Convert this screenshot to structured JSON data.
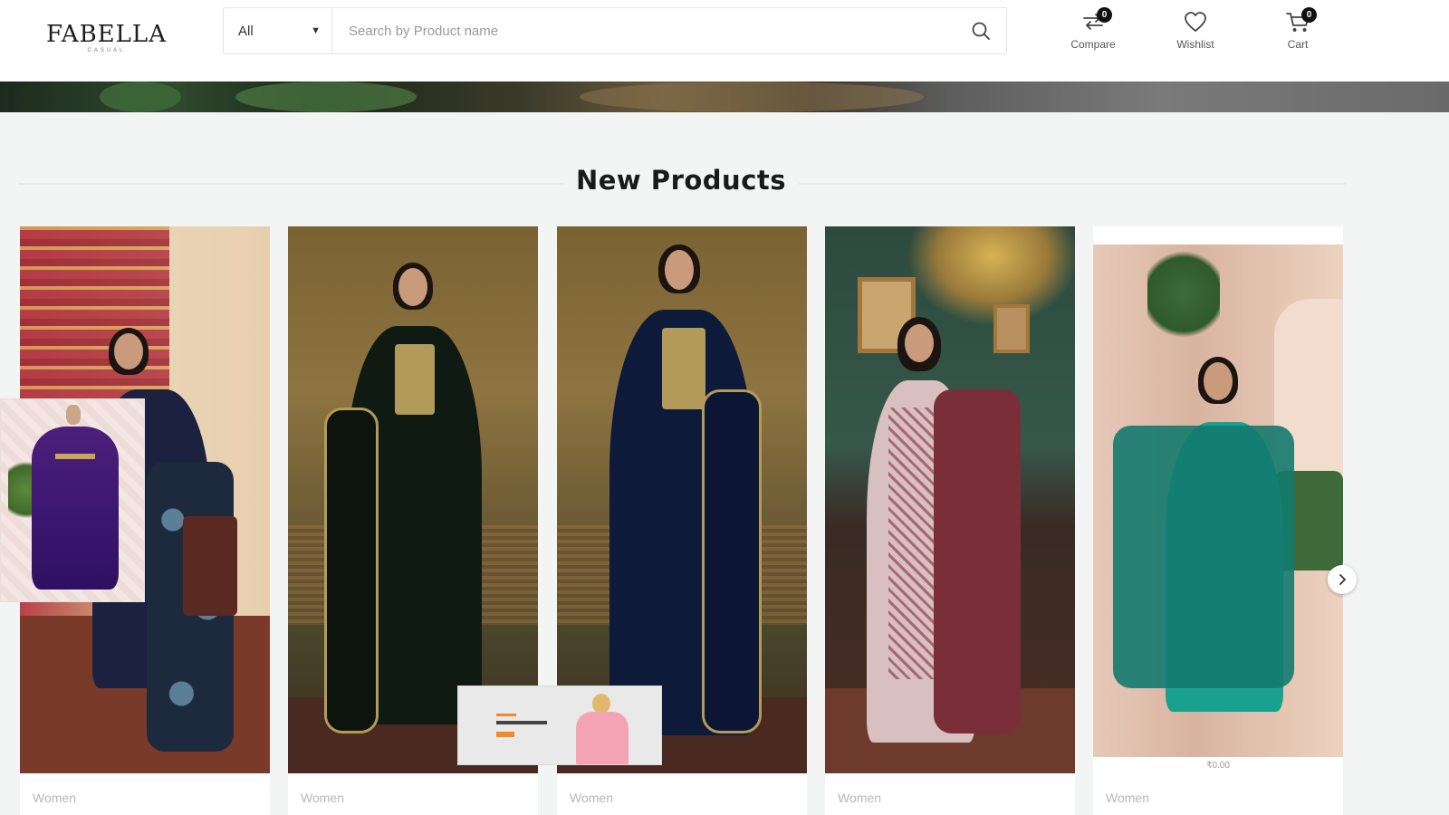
{
  "header": {
    "logo_main": "FABELLA",
    "logo_sub": "CASUAL",
    "search": {
      "category": "All",
      "placeholder": "Search by Product name"
    },
    "actions": [
      {
        "label": "Compare",
        "badge": "0",
        "icon": "compare-icon"
      },
      {
        "label": "Wishlist",
        "badge": "",
        "icon": "heart-icon"
      },
      {
        "label": "Cart",
        "badge": "0",
        "icon": "cart-icon"
      }
    ]
  },
  "section": {
    "title": "New Products"
  },
  "products": [
    {
      "category": "Women",
      "price_tag": "",
      "dress_color": "#1c2140",
      "accent": "#3e5f7a"
    },
    {
      "category": "Women",
      "price_tag": "",
      "dress_color": "#0f1a12",
      "accent": "#b29a5a"
    },
    {
      "category": "Women",
      "price_tag": "",
      "dress_color": "#0e1a3a",
      "accent": "#b49a58"
    },
    {
      "category": "Women",
      "price_tag": "",
      "dress_color": "#d8bfc0",
      "accent": "#7a2e3a"
    },
    {
      "category": "Women",
      "price_tag": "₹0.00",
      "dress_color": "#1aa08f",
      "accent": "#137a6e"
    }
  ],
  "colors": {
    "page_bg": "#f3f5f5",
    "badge": "#111111"
  }
}
